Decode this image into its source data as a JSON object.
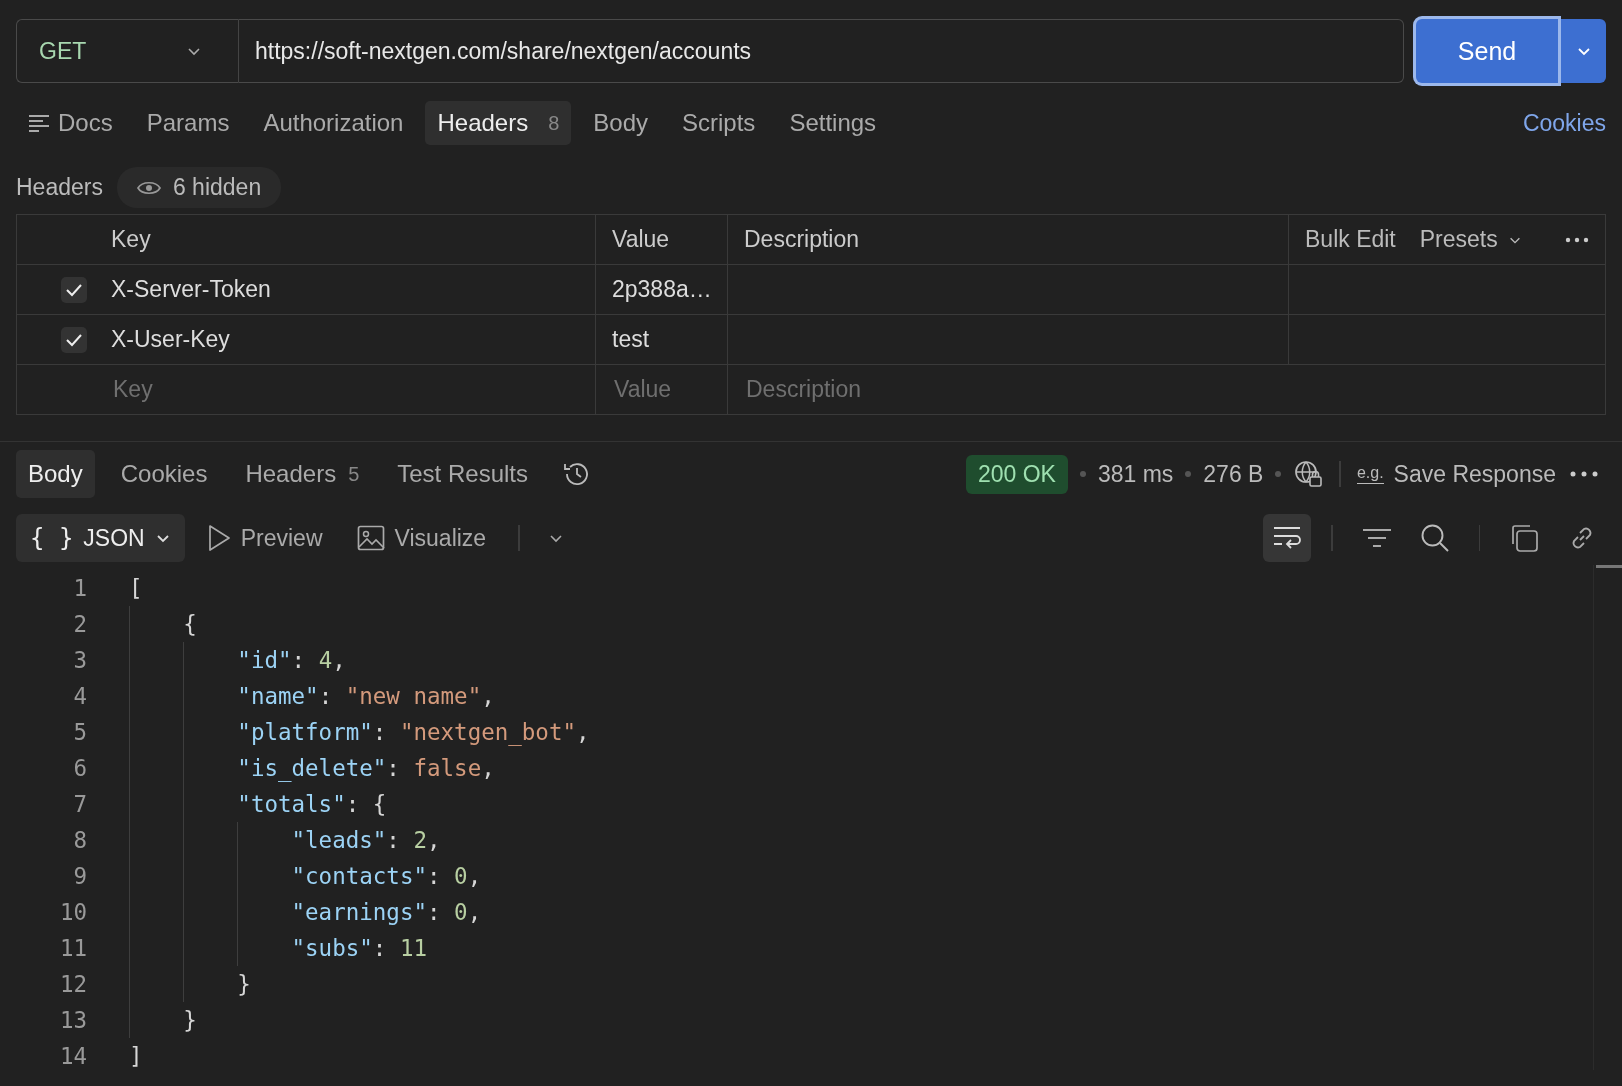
{
  "request": {
    "method": "GET",
    "url": "https://soft-nextgen.com/share/nextgen/accounts",
    "send": "Send"
  },
  "request_tabs": [
    {
      "label": "Docs",
      "kind": "docs",
      "selected": false
    },
    {
      "label": "Params",
      "kind": "tab",
      "selected": false
    },
    {
      "label": "Authorization",
      "kind": "tab",
      "selected": false
    },
    {
      "label": "Headers",
      "kind": "tab",
      "count": "8",
      "selected": true
    },
    {
      "label": "Body",
      "kind": "tab",
      "selected": false
    },
    {
      "label": "Scripts",
      "kind": "tab",
      "selected": false
    },
    {
      "label": "Settings",
      "kind": "tab",
      "selected": false
    }
  ],
  "cookies_link": "Cookies",
  "headers_section": {
    "title": "Headers",
    "hidden_badge": "6 hidden"
  },
  "headers_table": {
    "columns": [
      "Key",
      "Value",
      "Description"
    ],
    "actions": [
      "Bulk Edit",
      "Presets"
    ],
    "rows": [
      {
        "checked": true,
        "key": "X-Server-Token",
        "value": "2p388a…"
      },
      {
        "checked": true,
        "key": "X-User-Key",
        "value": "test"
      }
    ],
    "new_row": {
      "key_placeholder": "Key",
      "value_placeholder": "Value",
      "description_placeholder": "Description"
    }
  },
  "response": {
    "tabs": [
      {
        "label": "Body",
        "selected": true
      },
      {
        "label": "Cookies",
        "selected": false
      },
      {
        "label": "Headers",
        "count": "5",
        "selected": false
      },
      {
        "label": "Test Results",
        "selected": false
      }
    ],
    "status": {
      "text": "200 OK",
      "kind": "success"
    },
    "time": "381 ms",
    "size": "276 B",
    "save": {
      "icon_text": "e.g.",
      "label": "Save Response"
    },
    "format": {
      "icon_text": "{ }",
      "label": "JSON"
    },
    "views": [
      "Preview",
      "Visualize"
    ],
    "word_wrap": {
      "selected": true
    }
  },
  "code_lines": [
    {
      "number": "1",
      "tokens": [
        {
          "kind": "punct",
          "text": "["
        }
      ],
      "children": [
        {
          "number": "2",
          "tokens": [
            {
              "kind": "punct",
              "text": "{"
            }
          ],
          "children": [
            {
              "number": "3",
              "tokens": [
                {
                  "kind": "key",
                  "text": "\"id\""
                },
                {
                  "kind": "punct",
                  "text": ": "
                },
                {
                  "kind": "number",
                  "text": "4"
                },
                {
                  "kind": "punct",
                  "text": ","
                }
              ]
            },
            {
              "number": "4",
              "tokens": [
                {
                  "kind": "key",
                  "text": "\"name\""
                },
                {
                  "kind": "punct",
                  "text": ": "
                },
                {
                  "kind": "string",
                  "text": "\"new name\""
                },
                {
                  "kind": "punct",
                  "text": ","
                }
              ]
            },
            {
              "number": "5",
              "tokens": [
                {
                  "kind": "key",
                  "text": "\"platform\""
                },
                {
                  "kind": "punct",
                  "text": ": "
                },
                {
                  "kind": "string",
                  "text": "\"nextgen_bot\""
                },
                {
                  "kind": "punct",
                  "text": ","
                }
              ]
            },
            {
              "number": "6",
              "tokens": [
                {
                  "kind": "key",
                  "text": "\"is_delete\""
                },
                {
                  "kind": "punct",
                  "text": ": "
                },
                {
                  "kind": "boolean",
                  "text": "false"
                },
                {
                  "kind": "punct",
                  "text": ","
                }
              ]
            },
            {
              "number": "7",
              "tokens": [
                {
                  "kind": "key",
                  "text": "\"totals\""
                },
                {
                  "kind": "punct",
                  "text": ": {"
                }
              ],
              "children": [
                {
                  "number": "8",
                  "tokens": [
                    {
                      "kind": "key",
                      "text": "\"leads\""
                    },
                    {
                      "kind": "punct",
                      "text": ": "
                    },
                    {
                      "kind": "number",
                      "text": "2"
                    },
                    {
                      "kind": "punct",
                      "text": ","
                    }
                  ]
                },
                {
                  "number": "9",
                  "tokens": [
                    {
                      "kind": "key",
                      "text": "\"contacts\""
                    },
                    {
                      "kind": "punct",
                      "text": ": "
                    },
                    {
                      "kind": "number",
                      "text": "0"
                    },
                    {
                      "kind": "punct",
                      "text": ","
                    }
                  ]
                },
                {
                  "number": "10",
                  "tokens": [
                    {
                      "kind": "key",
                      "text": "\"earnings\""
                    },
                    {
                      "kind": "punct",
                      "text": ": "
                    },
                    {
                      "kind": "number",
                      "text": "0"
                    },
                    {
                      "kind": "punct",
                      "text": ","
                    }
                  ]
                },
                {
                  "number": "11",
                  "tokens": [
                    {
                      "kind": "key",
                      "text": "\"subs\""
                    },
                    {
                      "kind": "punct",
                      "text": ": "
                    },
                    {
                      "kind": "number",
                      "text": "11"
                    }
                  ]
                }
              ]
            },
            {
              "number": "12",
              "tokens": [
                {
                  "kind": "punct",
                  "text": "}"
                }
              ]
            }
          ]
        },
        {
          "number": "13",
          "tokens": [
            {
              "kind": "punct",
              "text": "}"
            }
          ]
        }
      ]
    },
    {
      "number": "14",
      "tokens": [
        {
          "kind": "punct",
          "text": "]"
        }
      ]
    }
  ]
}
